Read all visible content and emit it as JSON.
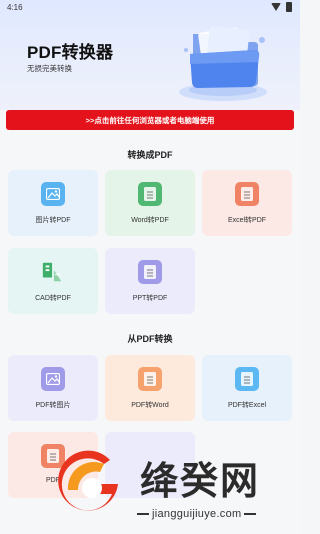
{
  "status": {
    "time": "4:16"
  },
  "header": {
    "title": "PDF转换器",
    "subtitle": "无损完美转换"
  },
  "banner": {
    "text": ">>点击前往任何浏览器或者电脑端使用"
  },
  "section_to_pdf": {
    "title": "转换成PDF",
    "items": [
      {
        "label": "图片转PDF",
        "icon": "image-icon"
      },
      {
        "label": "Word转PDF",
        "icon": "word-icon"
      },
      {
        "label": "Excel转PDF",
        "icon": "excel-icon"
      },
      {
        "label": "CAD转PDF",
        "icon": "cad-icon"
      },
      {
        "label": "PPT转PDF",
        "icon": "ppt-icon"
      }
    ]
  },
  "section_from_pdf": {
    "title": "从PDF转换",
    "items": [
      {
        "label": "PDF转图片",
        "icon": "image-icon"
      },
      {
        "label": "PDF转Word",
        "icon": "word-icon"
      },
      {
        "label": "PDF转Excel",
        "icon": "excel-icon"
      },
      {
        "label": "PDF",
        "icon": "ppt-icon"
      }
    ]
  },
  "watermark": {
    "brand": "绛癸网",
    "url": "jiangguijiuye.com"
  },
  "colors": {
    "banner": "#e3121b",
    "header_bg": "#dfe8ff"
  }
}
